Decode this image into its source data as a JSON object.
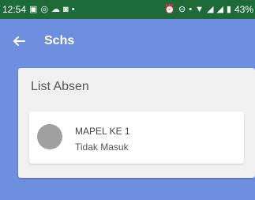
{
  "status_bar": {
    "time": "12:54",
    "left_icons": [
      "image-notification-icon",
      "whatsapp-icon",
      "cloud-icon",
      "instagram-icon",
      "dot-icon"
    ],
    "right_icons": [
      "alarm-icon",
      "do-not-disturb-icon",
      "dot-icon",
      "wifi-icon",
      "signal-icon",
      "signal-icon",
      "battery-icon"
    ],
    "battery": "43%"
  },
  "app_bar": {
    "title": "Schs",
    "back_icon": "arrow-left-icon"
  },
  "card": {
    "title": "List Absen",
    "items": [
      {
        "title": "MAPEL KE 1",
        "subtitle": "Tidak Masuk"
      }
    ]
  },
  "colors": {
    "status_bar": "#1e6b3a",
    "app_bar": "#6e8fe0",
    "card": "#f0f0f0",
    "avatar": "#a0a0a0"
  }
}
